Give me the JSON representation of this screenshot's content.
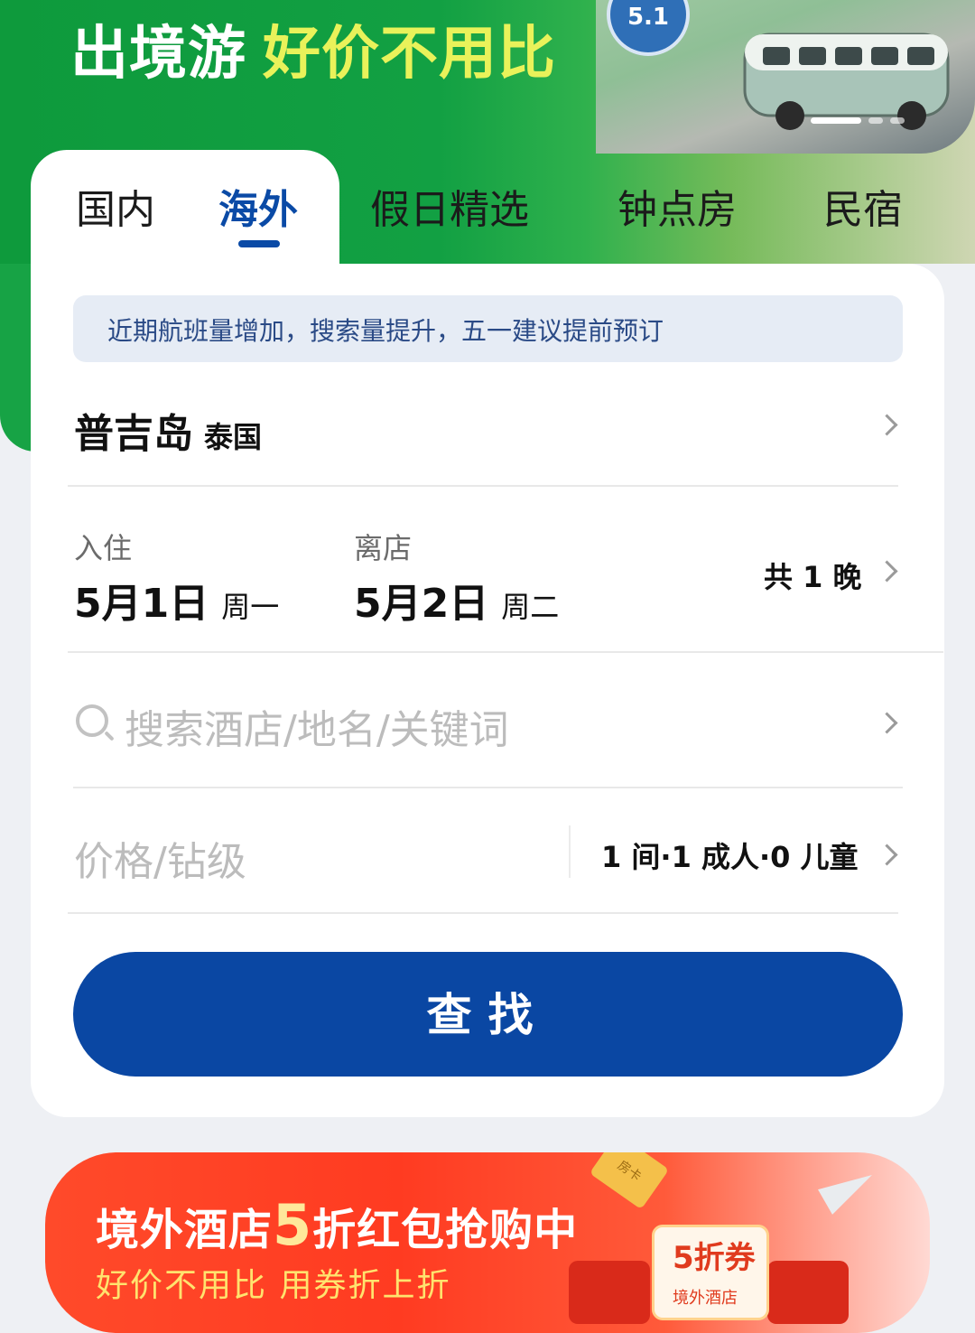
{
  "banner": {
    "title_white": "出境游",
    "title_highlight": "好价不用比",
    "badge": "5.1"
  },
  "tabs": [
    {
      "label": "国内",
      "active": false
    },
    {
      "label": "海外",
      "active": true
    },
    {
      "label": "假日精选",
      "active": false
    },
    {
      "label": "钟点房",
      "active": false
    },
    {
      "label": "民宿",
      "active": false
    }
  ],
  "notice": "近期航班量增加，搜索量提升，五一建议提前预订",
  "destination": {
    "city": "普吉岛",
    "country": "泰国"
  },
  "checkin": {
    "label": "入住",
    "date": "5月1日",
    "weekday": "周一"
  },
  "checkout": {
    "label": "离店",
    "date": "5月2日",
    "weekday": "周二"
  },
  "nights": "共 1 晚",
  "search": {
    "placeholder": "搜索酒店/地名/关键词"
  },
  "price": {
    "placeholder": "价格/钻级"
  },
  "guests": "1 间·1 成人·0 儿童",
  "search_button": "查找",
  "promo": {
    "title_pre": "境外酒店",
    "title_num": "5",
    "title_post": "折红包抢购中",
    "subtitle": "好价不用比  用券折上折",
    "coupon_main": "5折券",
    "coupon_sub": "境外酒店",
    "card_label": "房卡"
  },
  "colors": {
    "brand_blue": "#0a47a3",
    "banner_green": "#12a043",
    "promo_red": "#ff3b21"
  }
}
